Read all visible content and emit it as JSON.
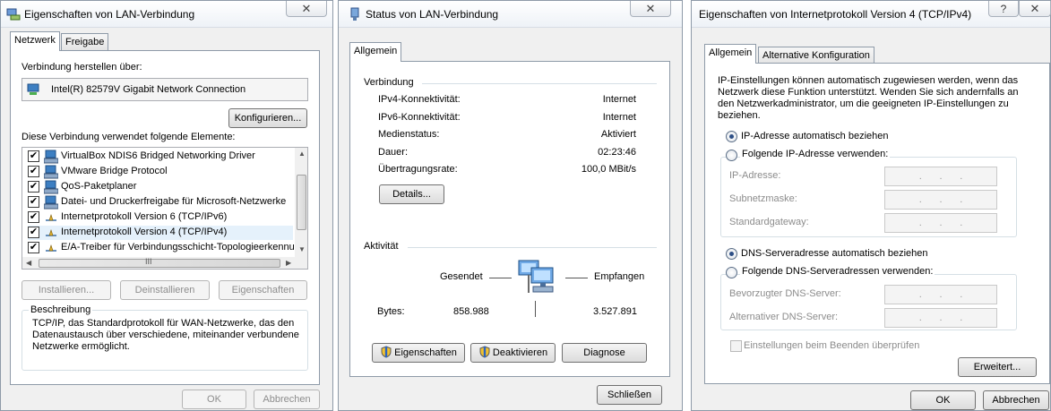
{
  "win1": {
    "title": "Eigenschaften von LAN-Verbindung",
    "tabs": [
      "Netzwerk",
      "Freigabe"
    ],
    "connect_label": "Verbindung herstellen über:",
    "adapter_name": "Intel(R) 82579V Gigabit Network Connection",
    "configure_btn": "Konfigurieren...",
    "elements_label": "Diese Verbindung verwendet folgende Elemente:",
    "items": [
      {
        "label": "VirtualBox NDIS6 Bridged Networking Driver",
        "icon": "network-adapter-icon"
      },
      {
        "label": "VMware Bridge Protocol",
        "icon": "network-adapter-icon"
      },
      {
        "label": "QoS-Paketplaner",
        "icon": "network-adapter-icon"
      },
      {
        "label": "Datei- und Druckerfreigabe für Microsoft-Netzwerke",
        "icon": "network-adapter-icon"
      },
      {
        "label": "Internetprotokoll Version 6 (TCP/IPv6)",
        "icon": "protocol-icon"
      },
      {
        "label": "Internetprotokoll Version 4 (TCP/IPv4)",
        "icon": "protocol-icon"
      },
      {
        "label": "E/A-Treiber für Verbindungsschicht-Topologieerkennur",
        "icon": "protocol-icon"
      }
    ],
    "scroll_grip": "III",
    "install_btn": "Installieren...",
    "uninstall_btn": "Deinstallieren",
    "properties_btn": "Eigenschaften",
    "description_title": "Beschreibung",
    "description_text": "TCP/IP, das Standardprotokoll für WAN-Netzwerke, das den Datenaustausch über verschiedene, miteinander verbundene Netzwerke ermöglicht.",
    "ok_btn": "OK",
    "cancel_btn": "Abbrechen"
  },
  "win2": {
    "title": "Status von LAN-Verbindung",
    "tab": "Allgemein",
    "connection_header": "Verbindung",
    "rows": [
      {
        "label": "IPv4-Konnektivität:",
        "value": "Internet"
      },
      {
        "label": "IPv6-Konnektivität:",
        "value": "Internet"
      },
      {
        "label": "Medienstatus:",
        "value": "Aktiviert"
      },
      {
        "label": "Dauer:",
        "value": "02:23:46"
      },
      {
        "label": "Übertragungsrate:",
        "value": "100,0 MBit/s"
      }
    ],
    "details_btn": "Details...",
    "activity_header": "Aktivität",
    "sent_label": "Gesendet",
    "received_label": "Empfangen",
    "bytes_label": "Bytes:",
    "bytes_sent": "858.988",
    "bytes_received": "3.527.891",
    "properties_btn": "Eigenschaften",
    "disable_btn": "Deaktivieren",
    "diagnose_btn": "Diagnose",
    "close_btn": "Schließen"
  },
  "win3": {
    "title": "Eigenschaften von Internetprotokoll Version 4 (TCP/IPv4)",
    "help": "?",
    "tabs": [
      "Allgemein",
      "Alternative Konfiguration"
    ],
    "intro": [
      "IP-Einstellungen können automatisch zugewiesen werden, wenn das",
      "Netzwerk diese Funktion unterstützt. Wenden Sie sich andernfalls an",
      "den Netzwerkadministrator, um die geeigneten IP-Einstellungen zu",
      "beziehen."
    ],
    "ip_auto": "IP-Adresse automatisch beziehen",
    "ip_manual": "Folgende IP-Adresse verwenden:",
    "ip_fields": [
      "IP-Adresse:",
      "Subnetzmaske:",
      "Standardgateway:"
    ],
    "dns_auto": "DNS-Serveradresse automatisch beziehen",
    "dns_manual": "Folgende DNS-Serveradressen verwenden:",
    "dns_fields": [
      "Bevorzugter DNS-Server:",
      "Alternativer DNS-Server:"
    ],
    "validate_label": "Einstellungen beim Beenden überprüfen",
    "advanced_btn": "Erweitert...",
    "ok_btn": "OK",
    "cancel_btn": "Abbrechen"
  }
}
